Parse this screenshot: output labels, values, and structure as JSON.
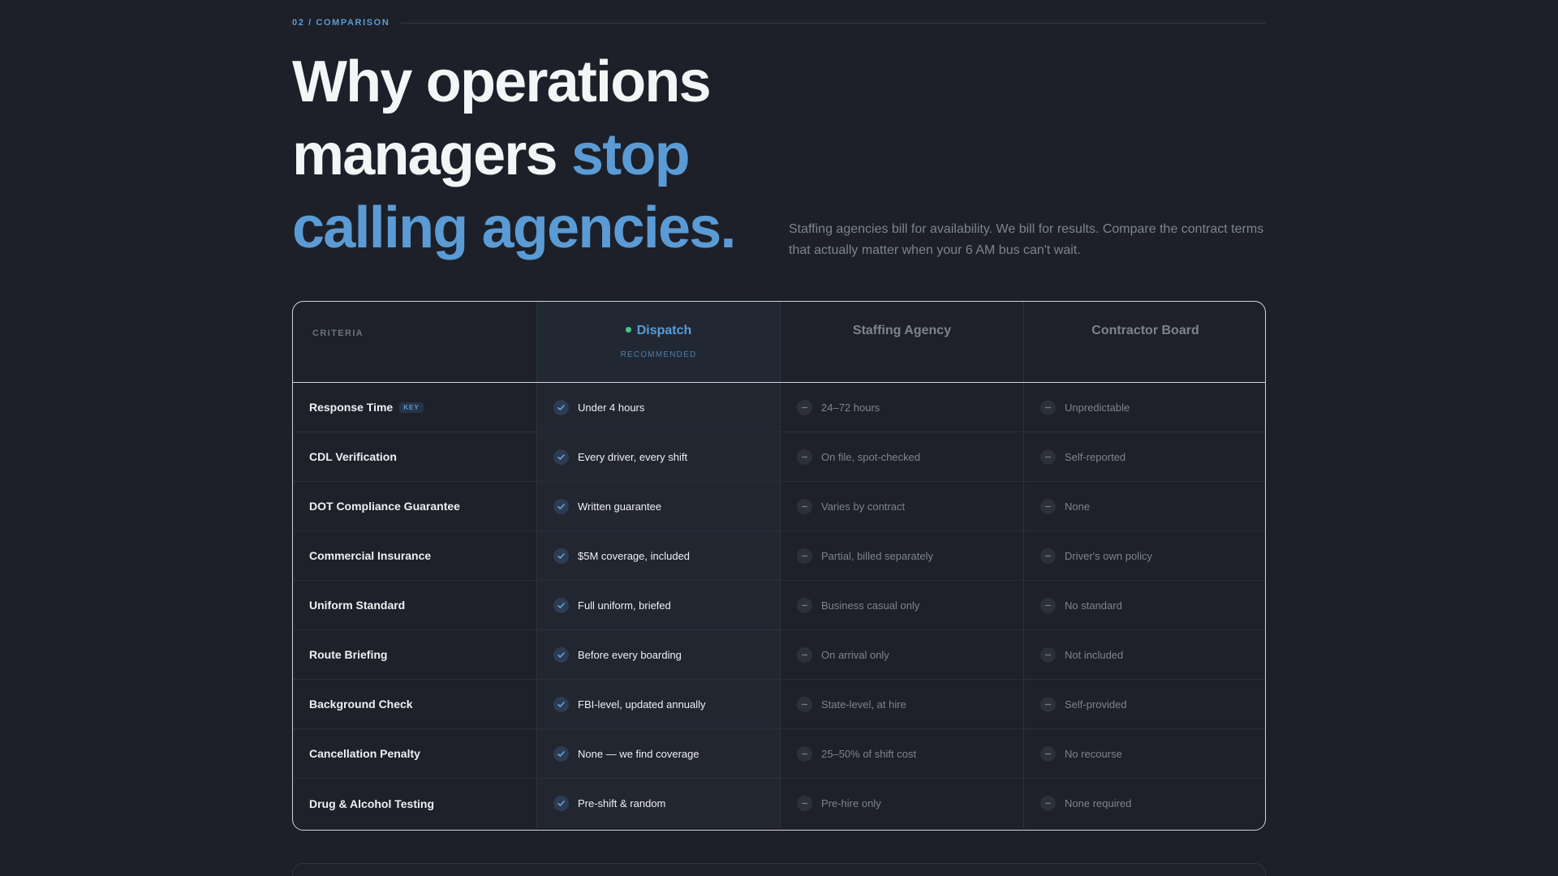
{
  "section": {
    "eyebrow": "02 / COMPARISON"
  },
  "headline": {
    "line1": "Why operations",
    "line2_plain": "managers ",
    "line2_accent": "stop",
    "line3_accent": "calling agencies."
  },
  "intro": "Staffing agencies bill for availability. We bill for results. Compare the contract terms that actually matter when your 6 AM bus can't wait.",
  "table": {
    "criteria_label": "CRITERIA",
    "columns": [
      {
        "title": "Dispatch",
        "subtitle": "RECOMMENDED",
        "featured": true
      },
      {
        "title": "Staffing Agency"
      },
      {
        "title": "Contractor Board"
      }
    ],
    "rows": [
      {
        "criterion": "Response Time",
        "badge": "KEY",
        "dispatch": "Under 4 hours",
        "agency": "24–72 hours",
        "board": "Unpredictable"
      },
      {
        "criterion": "CDL Verification",
        "dispatch": "Every driver, every shift",
        "agency": "On file, spot-checked",
        "board": "Self-reported"
      },
      {
        "criterion": "DOT Compliance Guarantee",
        "dispatch": "Written guarantee",
        "agency": "Varies by contract",
        "board": "None"
      },
      {
        "criterion": "Commercial Insurance",
        "dispatch": "$5M coverage, included",
        "agency": "Partial, billed separately",
        "board": "Driver's own policy"
      },
      {
        "criterion": "Uniform Standard",
        "dispatch": "Full uniform, briefed",
        "agency": "Business casual only",
        "board": "No standard"
      },
      {
        "criterion": "Route Briefing",
        "dispatch": "Before every boarding",
        "agency": "On arrival only",
        "board": "Not included"
      },
      {
        "criterion": "Background Check",
        "dispatch": "FBI-level, updated annually",
        "agency": "State-level, at hire",
        "board": "Self-provided"
      },
      {
        "criterion": "Cancellation Penalty",
        "dispatch": "None — we find coverage",
        "agency": "25–50% of shift cost",
        "board": "No recourse"
      },
      {
        "criterion": "Drug & Alcohol Testing",
        "dispatch": "Pre-shift & random",
        "agency": "Pre-hire only",
        "board": "None required"
      }
    ]
  },
  "icons": {
    "included": "check-icon",
    "not_included": "dash-icon"
  },
  "colors": {
    "accent": "#5b9bd5",
    "background": "#1d2028",
    "status_dot": "#4cc38a"
  }
}
